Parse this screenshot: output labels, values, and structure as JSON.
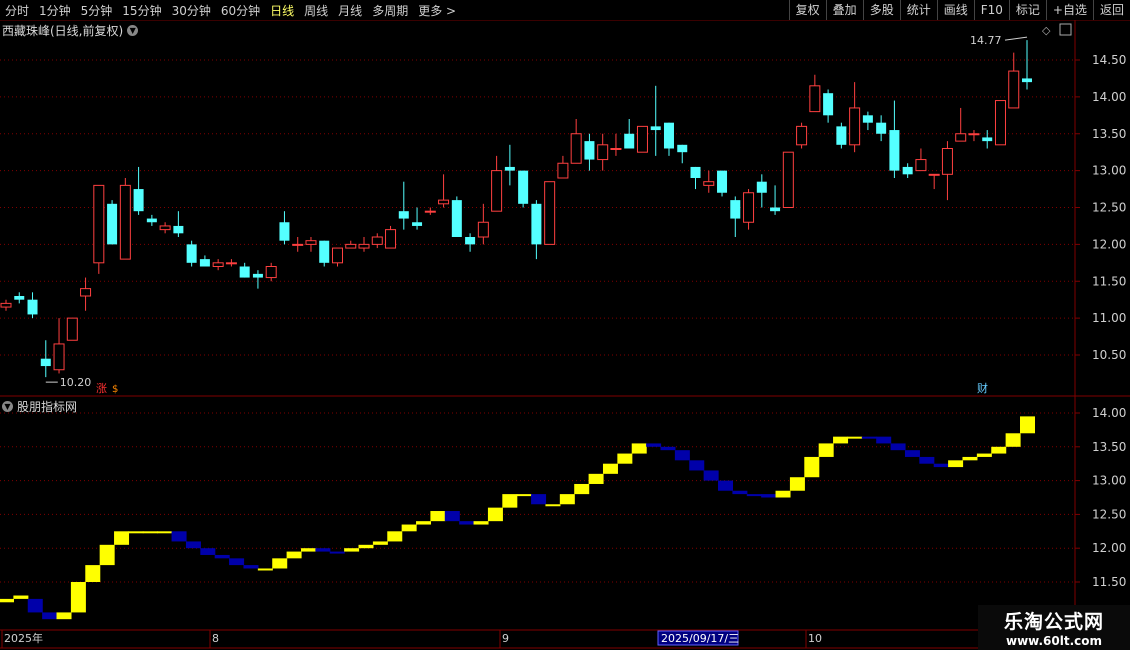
{
  "toolbar": {
    "periods": [
      {
        "label": "分时",
        "active": false
      },
      {
        "label": "1分钟",
        "active": false
      },
      {
        "label": "5分钟",
        "active": false
      },
      {
        "label": "15分钟",
        "active": false
      },
      {
        "label": "30分钟",
        "active": false
      },
      {
        "label": "60分钟",
        "active": false
      },
      {
        "label": "日线",
        "active": true
      },
      {
        "label": "周线",
        "active": false
      },
      {
        "label": "月线",
        "active": false
      },
      {
        "label": "多周期",
        "active": false
      },
      {
        "label": "更多 >",
        "active": false
      }
    ],
    "tools": [
      "复权",
      "叠加",
      "多股",
      "统计",
      "画线",
      "F10",
      "标记",
      "+自选",
      "返回"
    ]
  },
  "main": {
    "title": "西藏珠峰(日线,前复权)",
    "high_label": "14.77",
    "low_label": "10.20",
    "tag_up": "涨",
    "tag_fin": "财",
    "y_ticks": [
      "14.50",
      "14.00",
      "13.50",
      "13.00",
      "12.50",
      "12.00",
      "11.50",
      "11.00",
      "10.50"
    ]
  },
  "indicator": {
    "title": "股朋指标网",
    "y_ticks": [
      "14.00",
      "13.50",
      "13.00",
      "12.50",
      "12.00",
      "11.50"
    ]
  },
  "xaxis": {
    "labels": [
      "2025年",
      "8",
      "9",
      "10"
    ],
    "cursor": "2025/09/17/三"
  },
  "watermark": {
    "line1": "乐淘公式网",
    "line2": "www.60lt.com"
  },
  "colors": {
    "up": "#ff4040",
    "down": "#54ffff",
    "ind_up": "#ffff00",
    "ind_down": "#0000aa",
    "grid": "#800000"
  },
  "chart_data": {
    "type": "candlestick",
    "price_ylim": [
      10.2,
      14.77
    ],
    "candles": [
      [
        11.15,
        11.2,
        11.1,
        11.25
      ],
      [
        11.3,
        11.25,
        11.2,
        11.35
      ],
      [
        11.25,
        11.05,
        11.0,
        11.35
      ],
      [
        10.45,
        10.35,
        10.2,
        10.7
      ],
      [
        10.3,
        10.65,
        10.25,
        11.0
      ],
      [
        10.7,
        11.0,
        10.7,
        11.0
      ],
      [
        11.3,
        11.4,
        11.1,
        11.55
      ],
      [
        11.75,
        12.8,
        11.6,
        12.8
      ],
      [
        12.55,
        12.0,
        12.0,
        12.6
      ],
      [
        11.8,
        12.8,
        11.8,
        12.9
      ],
      [
        12.75,
        12.45,
        12.4,
        13.05
      ],
      [
        12.35,
        12.3,
        12.25,
        12.4
      ],
      [
        12.2,
        12.25,
        12.15,
        12.3
      ],
      [
        12.25,
        12.15,
        12.1,
        12.45
      ],
      [
        12.0,
        11.75,
        11.7,
        12.05
      ],
      [
        11.8,
        11.7,
        11.7,
        11.85
      ],
      [
        11.7,
        11.75,
        11.65,
        11.8
      ],
      [
        11.75,
        11.75,
        11.7,
        11.8
      ],
      [
        11.7,
        11.55,
        11.55,
        11.75
      ],
      [
        11.6,
        11.55,
        11.4,
        11.65
      ],
      [
        11.55,
        11.7,
        11.5,
        11.75
      ],
      [
        12.3,
        12.05,
        12.0,
        12.45
      ],
      [
        12.0,
        12.0,
        11.9,
        12.1
      ],
      [
        12.0,
        12.05,
        11.9,
        12.1
      ],
      [
        12.05,
        11.75,
        11.7,
        12.05
      ],
      [
        11.75,
        11.95,
        11.7,
        11.95
      ],
      [
        11.95,
        12.0,
        11.95,
        12.05
      ],
      [
        11.95,
        12.0,
        11.9,
        12.1
      ],
      [
        12.0,
        12.1,
        11.95,
        12.15
      ],
      [
        11.95,
        12.2,
        11.95,
        12.25
      ],
      [
        12.45,
        12.35,
        12.2,
        12.85
      ],
      [
        12.3,
        12.25,
        12.2,
        12.5
      ],
      [
        12.45,
        12.45,
        12.4,
        12.5
      ],
      [
        12.55,
        12.6,
        12.5,
        12.95
      ],
      [
        12.6,
        12.1,
        12.1,
        12.65
      ],
      [
        12.1,
        12.0,
        11.9,
        12.15
      ],
      [
        12.1,
        12.3,
        12.0,
        12.55
      ],
      [
        12.45,
        13.0,
        12.45,
        13.2
      ],
      [
        13.05,
        13.0,
        12.8,
        13.35
      ],
      [
        13.0,
        12.55,
        12.5,
        13.0
      ],
      [
        12.55,
        12.0,
        11.8,
        12.6
      ],
      [
        12.0,
        12.85,
        12.0,
        12.85
      ],
      [
        12.9,
        13.1,
        12.9,
        13.2
      ],
      [
        13.1,
        13.5,
        13.1,
        13.7
      ],
      [
        13.4,
        13.15,
        13.0,
        13.5
      ],
      [
        13.15,
        13.35,
        13.0,
        13.5
      ],
      [
        13.3,
        13.3,
        13.2,
        13.5
      ],
      [
        13.5,
        13.3,
        13.3,
        13.7
      ],
      [
        13.25,
        13.6,
        13.25,
        13.6
      ],
      [
        13.6,
        13.55,
        13.2,
        14.15
      ],
      [
        13.65,
        13.3,
        13.2,
        13.65
      ],
      [
        13.35,
        13.25,
        13.1,
        13.35
      ],
      [
        13.05,
        12.9,
        12.75,
        13.05
      ],
      [
        12.8,
        12.85,
        12.7,
        13.0
      ],
      [
        13.0,
        12.7,
        12.65,
        13.0
      ],
      [
        12.6,
        12.35,
        12.1,
        12.65
      ],
      [
        12.3,
        12.7,
        12.2,
        12.75
      ],
      [
        12.85,
        12.7,
        12.5,
        12.95
      ],
      [
        12.5,
        12.45,
        12.4,
        12.8
      ],
      [
        12.5,
        13.25,
        12.5,
        13.25
      ],
      [
        13.35,
        13.6,
        13.3,
        13.65
      ],
      [
        13.8,
        14.15,
        13.8,
        14.3
      ],
      [
        14.05,
        13.75,
        13.65,
        14.1
      ],
      [
        13.6,
        13.35,
        13.3,
        13.65
      ],
      [
        13.35,
        13.85,
        13.25,
        14.2
      ],
      [
        13.75,
        13.65,
        13.55,
        13.8
      ],
      [
        13.65,
        13.5,
        13.4,
        13.75
      ],
      [
        13.55,
        13.0,
        12.9,
        13.95
      ],
      [
        13.05,
        12.95,
        12.9,
        13.1
      ],
      [
        13.0,
        13.15,
        13.0,
        13.3
      ],
      [
        12.95,
        12.95,
        12.75,
        12.95
      ],
      [
        12.95,
        13.3,
        12.6,
        13.4
      ],
      [
        13.4,
        13.5,
        13.4,
        13.85
      ],
      [
        13.5,
        13.5,
        13.4,
        13.55
      ],
      [
        13.45,
        13.4,
        13.3,
        13.55
      ],
      [
        13.35,
        13.95,
        13.35,
        13.95
      ],
      [
        13.85,
        14.35,
        13.85,
        14.6
      ],
      [
        14.25,
        14.2,
        14.1,
        14.77
      ]
    ],
    "indicator_ylim": [
      11.3,
      14.2
    ],
    "indicator_steps": [
      [
        11.2,
        11.25,
        "up"
      ],
      [
        11.25,
        11.3,
        "up"
      ],
      [
        11.25,
        11.05,
        "down"
      ],
      [
        11.05,
        10.95,
        "down"
      ],
      [
        10.95,
        11.05,
        "up"
      ],
      [
        11.05,
        11.5,
        "up"
      ],
      [
        11.5,
        11.75,
        "up"
      ],
      [
        11.75,
        12.05,
        "up"
      ],
      [
        12.05,
        12.25,
        "up"
      ],
      [
        12.25,
        12.25,
        "up"
      ],
      [
        12.25,
        12.25,
        "up"
      ],
      [
        12.25,
        12.25,
        "up"
      ],
      [
        12.25,
        12.1,
        "down"
      ],
      [
        12.1,
        12.0,
        "down"
      ],
      [
        12.0,
        11.9,
        "down"
      ],
      [
        11.9,
        11.85,
        "down"
      ],
      [
        11.85,
        11.75,
        "down"
      ],
      [
        11.75,
        11.7,
        "down"
      ],
      [
        11.7,
        11.7,
        "up"
      ],
      [
        11.7,
        11.85,
        "up"
      ],
      [
        11.85,
        11.95,
        "up"
      ],
      [
        11.95,
        12.0,
        "up"
      ],
      [
        12.0,
        11.95,
        "down"
      ],
      [
        11.95,
        11.95,
        "down"
      ],
      [
        11.95,
        12.0,
        "up"
      ],
      [
        12.0,
        12.05,
        "up"
      ],
      [
        12.05,
        12.1,
        "up"
      ],
      [
        12.1,
        12.25,
        "up"
      ],
      [
        12.25,
        12.35,
        "up"
      ],
      [
        12.35,
        12.4,
        "up"
      ],
      [
        12.4,
        12.55,
        "up"
      ],
      [
        12.55,
        12.4,
        "down"
      ],
      [
        12.4,
        12.35,
        "down"
      ],
      [
        12.35,
        12.4,
        "up"
      ],
      [
        12.4,
        12.6,
        "up"
      ],
      [
        12.6,
        12.8,
        "up"
      ],
      [
        12.8,
        12.8,
        "up"
      ],
      [
        12.8,
        12.65,
        "down"
      ],
      [
        12.65,
        12.65,
        "up"
      ],
      [
        12.65,
        12.8,
        "up"
      ],
      [
        12.8,
        12.95,
        "up"
      ],
      [
        12.95,
        13.1,
        "up"
      ],
      [
        13.1,
        13.25,
        "up"
      ],
      [
        13.25,
        13.4,
        "up"
      ],
      [
        13.4,
        13.55,
        "up"
      ],
      [
        13.55,
        13.5,
        "down"
      ],
      [
        13.5,
        13.45,
        "down"
      ],
      [
        13.45,
        13.3,
        "down"
      ],
      [
        13.3,
        13.15,
        "down"
      ],
      [
        13.15,
        13.0,
        "down"
      ],
      [
        13.0,
        12.85,
        "down"
      ],
      [
        12.85,
        12.8,
        "down"
      ],
      [
        12.8,
        12.8,
        "down"
      ],
      [
        12.8,
        12.75,
        "down"
      ],
      [
        12.75,
        12.85,
        "up"
      ],
      [
        12.85,
        13.05,
        "up"
      ],
      [
        13.05,
        13.35,
        "up"
      ],
      [
        13.35,
        13.55,
        "up"
      ],
      [
        13.55,
        13.65,
        "up"
      ],
      [
        13.65,
        13.65,
        "up"
      ],
      [
        13.65,
        13.65,
        "down"
      ],
      [
        13.65,
        13.55,
        "down"
      ],
      [
        13.55,
        13.45,
        "down"
      ],
      [
        13.45,
        13.35,
        "down"
      ],
      [
        13.35,
        13.25,
        "down"
      ],
      [
        13.25,
        13.2,
        "down"
      ],
      [
        13.2,
        13.3,
        "up"
      ],
      [
        13.3,
        13.35,
        "up"
      ],
      [
        13.35,
        13.4,
        "up"
      ],
      [
        13.4,
        13.5,
        "up"
      ],
      [
        13.5,
        13.7,
        "up"
      ],
      [
        13.7,
        13.95,
        "up"
      ]
    ]
  }
}
